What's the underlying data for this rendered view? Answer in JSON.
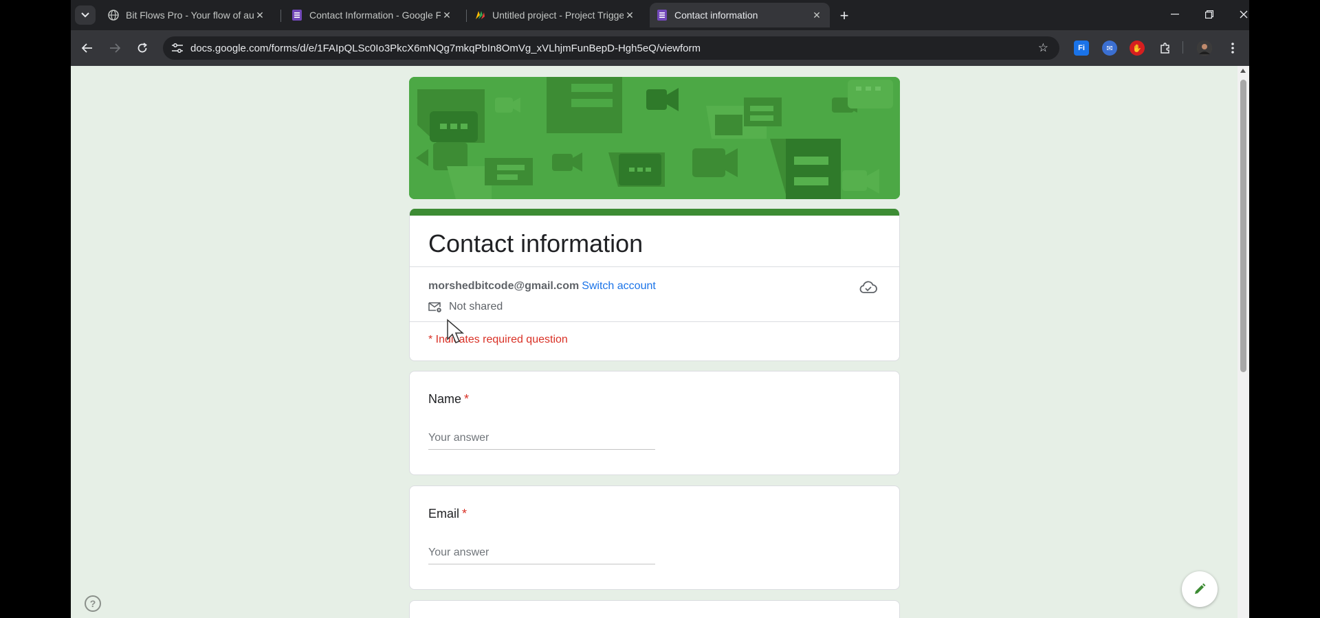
{
  "browser": {
    "tabs": [
      {
        "title": "Bit Flows Pro - Your flow of automation",
        "active": false
      },
      {
        "title": "Contact Information - Google Forms",
        "active": false
      },
      {
        "title": "Untitled project - Project Trigger",
        "active": false
      },
      {
        "title": "Contact information",
        "active": true
      }
    ],
    "new_tab_label": "+",
    "url": "docs.google.com/forms/d/e/1FAIpQLSc0Io3PkcX6mNQg7mkqPbIn8OmVg_xVLhjmFunBepD-Hgh5eQ/viewform",
    "extensions": [
      {
        "name": "fi-extension-icon",
        "label": "Fi",
        "color": "#1a73e8"
      },
      {
        "name": "extension-icon-2",
        "label": "✉",
        "color": "#3b6fd1"
      },
      {
        "name": "extension-icon-3",
        "label": "✋",
        "color": "#d61f1f"
      }
    ]
  },
  "form": {
    "title": "Contact information",
    "account_email": "morshedbitcode@gmail.com",
    "switch_account": "Switch account",
    "not_shared": "Not shared",
    "required_note": "* Indicates required question",
    "questions": [
      {
        "label": "Name",
        "required_mark": "*",
        "placeholder": "Your answer"
      },
      {
        "label": "Email",
        "required_mark": "*",
        "placeholder": "Your answer"
      }
    ]
  },
  "colors": {
    "theme": "#3d8c34",
    "banner": "#4ca845",
    "background": "#e6efe6",
    "required": "#d93025",
    "link": "#1a73e8"
  }
}
